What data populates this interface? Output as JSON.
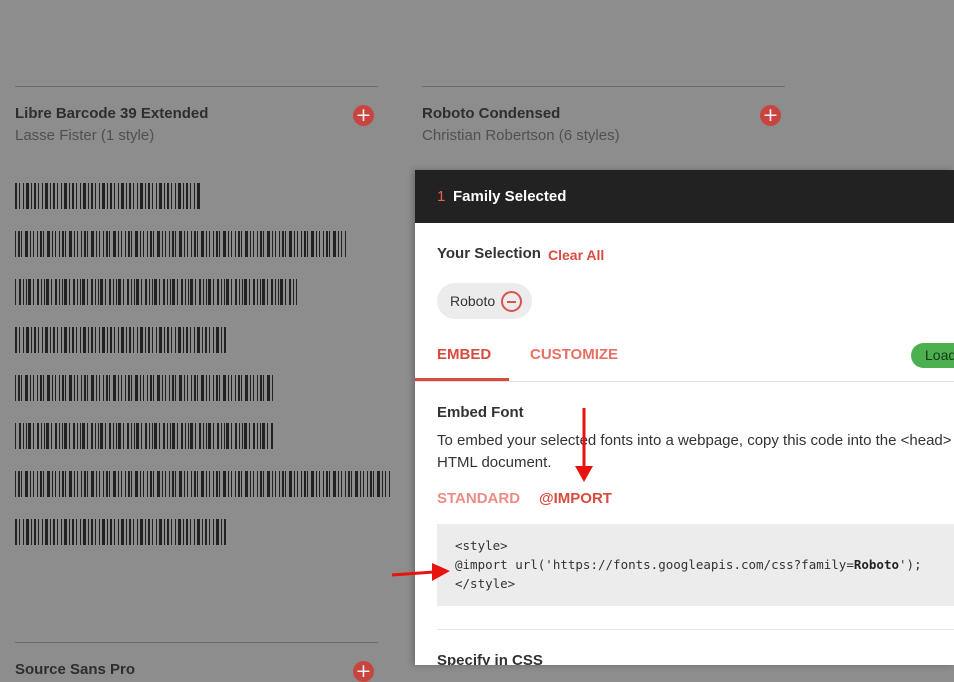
{
  "cards": [
    {
      "family": "Libre Barcode 39 Extended",
      "designer": "Lasse Fister (1 style)"
    },
    {
      "family": "Roboto Condensed",
      "designer": "Christian Robertson (6 styles)"
    },
    {
      "family": "Source Sans Pro",
      "designer": ""
    }
  ],
  "add_icon": "+",
  "panel": {
    "count": "1",
    "title": "Family Selected",
    "your_selection": "Your Selection",
    "clear_all": "Clear All",
    "chip_label": "Roboto",
    "chip_icon": "remove-circle-icon",
    "tabs": {
      "embed": "EMBED",
      "customize": "CUSTOMIZE"
    },
    "load_button": "Load",
    "embed_heading": "Embed Font",
    "embed_desc_line1": "To embed your selected fonts into a webpage, copy this code into the <head> of your",
    "embed_desc_line2": "HTML document.",
    "subtabs": {
      "standard": "STANDARD",
      "import": "@IMPORT"
    },
    "code": {
      "line1": "<style>",
      "line2_pre": "@import url('https://fonts.googleapis.com/css?family=",
      "line2_bold": "Roboto",
      "line2_post": "');",
      "line3": "</style>"
    },
    "specify_heading": "Specify in CSS"
  },
  "colors": {
    "accent": "#d84b3e",
    "accent_light": "#e76f63",
    "header_bg": "#222222",
    "overlay_bg": "#8d8d8d",
    "load_green": "#4caf50",
    "annotation_arrow": "#e8130f"
  }
}
